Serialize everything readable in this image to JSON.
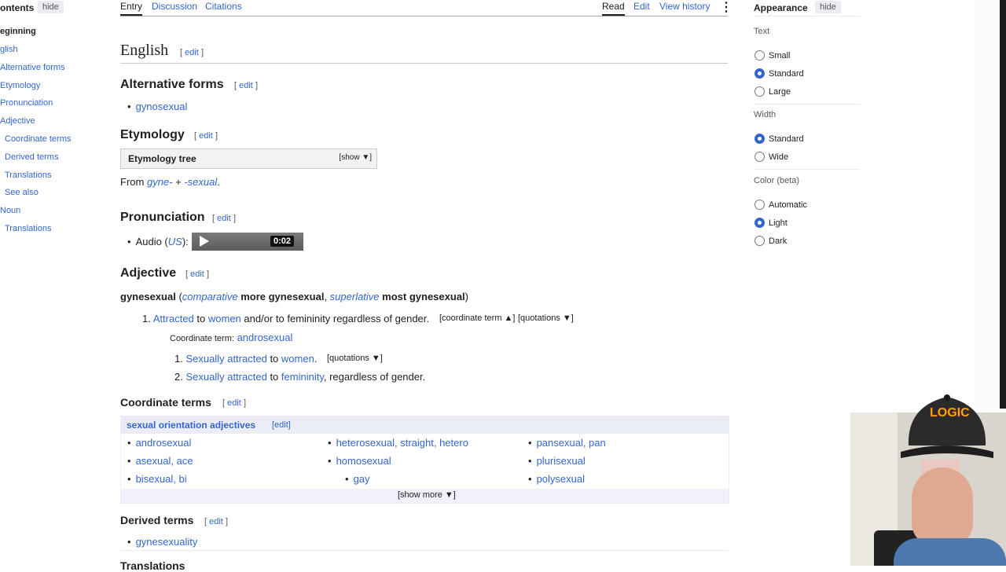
{
  "toc": {
    "header": "ontents",
    "hide": "hide",
    "items": [
      {
        "label": "eginning"
      },
      {
        "label": "glish"
      },
      {
        "label": "Alternative forms"
      },
      {
        "label": "Etymology"
      },
      {
        "label": "Pronunciation"
      },
      {
        "label": "Adjective"
      },
      {
        "label": "Coordinate terms"
      },
      {
        "label": "Derived terms"
      },
      {
        "label": "Translations"
      },
      {
        "label": "See also"
      },
      {
        "label": "Noun"
      },
      {
        "label": "Translations"
      }
    ]
  },
  "tabs": {
    "left": [
      "Entry",
      "Discussion",
      "Citations"
    ],
    "right": [
      "Read",
      "Edit",
      "View history"
    ],
    "more": "⋮"
  },
  "edit_open": "[",
  "edit_label": "edit",
  "edit_close": "]",
  "sections": {
    "english": "English",
    "alt_forms": "Alternative forms",
    "alt_form_item": "gynosexual",
    "etymology": "Etymology",
    "ety_tree": "Etymology tree",
    "ety_show": "[show ▼]",
    "ety_text": {
      "prefix": "From",
      "a": "gyne-",
      "plus": "+",
      "b": "-sexual",
      "end": "."
    },
    "pronunciation": "Pronunciation",
    "audio_label": "Audio (",
    "audio_region": "US",
    "audio_suffix": "):",
    "audio_time": "0:02",
    "adjective": "Adjective",
    "headword": "gynesexual",
    "comparative": "comparative",
    "more": "more gynesexual",
    "superlative": "superlative",
    "most": "most gynesexual",
    "def1": {
      "num": "1.",
      "a": "Attracted",
      "to": "to",
      "b": "women",
      "rest": "and/or to femininity regardless of gender.",
      "coord_toggle": "[coordinate term ▲]",
      "quot_toggle": "[quotations ▼]"
    },
    "coord_label": "Coordinate term:",
    "coord_term": "androsexual",
    "sub1": {
      "num": "1.",
      "a": "Sexually attracted",
      "to": "to",
      "b": "women",
      "end": ".",
      "quot": "[quotations ▼]"
    },
    "sub2": {
      "num": "2.",
      "a": "Sexually attracted",
      "to": "to",
      "b": "femininity",
      "end": ", regardless of gender."
    },
    "coordinate_terms": "Coordinate terms",
    "ct_title": "sexual orientation adjectives",
    "ct_edit": "[edit]",
    "ct_cols": [
      [
        "androsexual",
        "asexual, ace",
        "bisexual, bi"
      ],
      [
        "heterosexual, straight, hetero",
        "homosexual",
        "gay"
      ],
      [
        "pansexual, pan",
        "plurisexual",
        "polysexual"
      ]
    ],
    "ct_more": "[show more ▼]",
    "derived_terms": "Derived terms",
    "derived_item": "gynesexuality",
    "translations_partial": "Translations"
  },
  "appearance": {
    "title": "Appearance",
    "hide": "hide",
    "text_label": "Text",
    "text_opts": [
      "Small",
      "Standard",
      "Large"
    ],
    "width_label": "Width",
    "width_opts": [
      "Standard",
      "Wide"
    ],
    "color_label": "Color (beta)",
    "color_opts": [
      "Automatic",
      "Light",
      "Dark"
    ]
  },
  "webcam": {
    "cap_text": "LOGIC"
  },
  "colors": {
    "link": "#3366cc",
    "radio_on": "#3366cc",
    "cap": "#2b2b2b",
    "cap_text": "#f2c200"
  }
}
